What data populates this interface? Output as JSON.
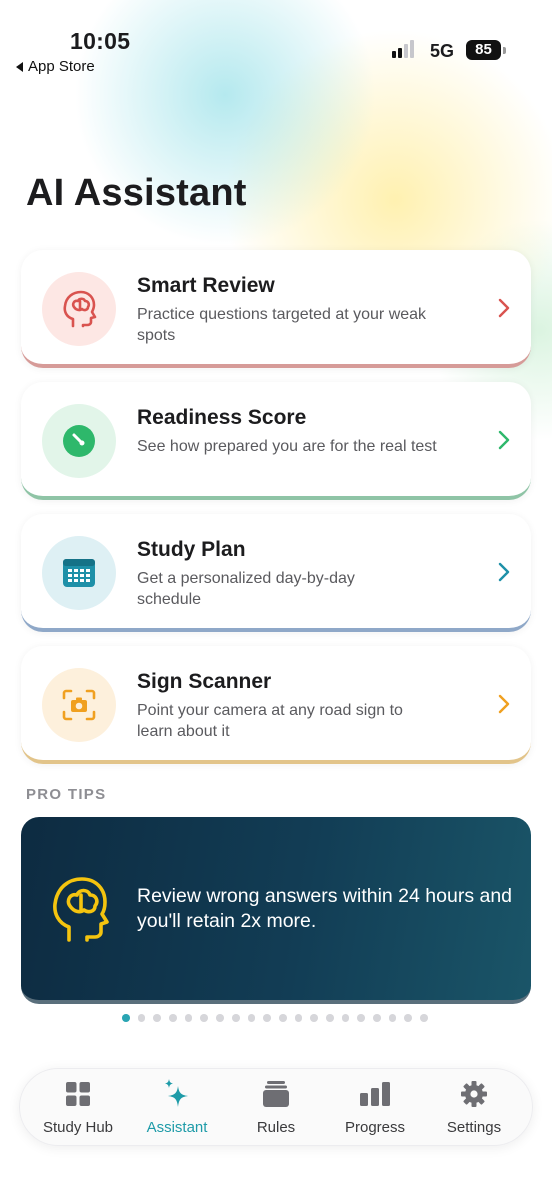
{
  "status_bar": {
    "time": "10:05",
    "back_label": "App Store",
    "network": "5G",
    "battery": "85"
  },
  "page": {
    "title": "AI Assistant"
  },
  "cards": [
    {
      "title": "Smart Review",
      "description": "Practice questions targeted at your weak spots",
      "icon": "brain-head-icon",
      "accent": "#d9534f"
    },
    {
      "title": "Readiness Score",
      "description": "See how prepared you are for the real test",
      "icon": "gauge-icon",
      "accent": "#2eb86b"
    },
    {
      "title": "Study Plan",
      "description": "Get a personalized day-by-day schedule",
      "icon": "calendar-icon",
      "accent": "#1e90a8"
    },
    {
      "title": "Sign Scanner",
      "description": "Point your camera at any road sign to learn about it",
      "icon": "camera-scan-icon",
      "accent": "#f0a020"
    }
  ],
  "pro_tips": {
    "label": "PRO TIPS",
    "text": "Review wrong answers within 24 hours and you'll retain 2x more.",
    "icon": "brain-head-icon",
    "page_count": 20,
    "active_page": 1
  },
  "tabs": [
    {
      "label": "Study Hub",
      "icon": "grid-icon",
      "active": false
    },
    {
      "label": "Assistant",
      "icon": "sparkle-icon",
      "active": true
    },
    {
      "label": "Rules",
      "icon": "stack-icon",
      "active": false
    },
    {
      "label": "Progress",
      "icon": "bar-chart-icon",
      "active": false
    },
    {
      "label": "Settings",
      "icon": "gear-icon",
      "active": false
    }
  ]
}
